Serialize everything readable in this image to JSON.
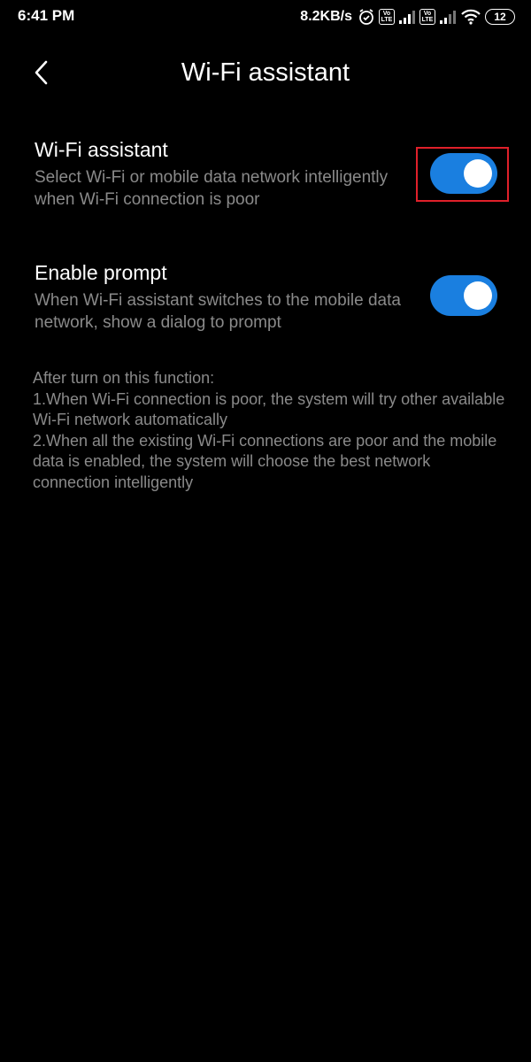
{
  "status_bar": {
    "time": "6:41 PM",
    "speed": "8.2KB/s",
    "battery": "12",
    "volte_label_top": "Vo",
    "volte_label_bottom": "LTE"
  },
  "header": {
    "title": "Wi-Fi assistant"
  },
  "settings": [
    {
      "title": "Wi-Fi assistant",
      "description": "Select Wi-Fi or mobile data network intelligently when Wi-Fi connection is poor",
      "enabled": true
    },
    {
      "title": "Enable prompt",
      "description": "When Wi-Fi assistant switches to the mobile data network, show a dialog to prompt",
      "enabled": true
    }
  ],
  "info": {
    "line1": "After turn on this function:",
    "line2": "1.When Wi-Fi connection is poor, the system will try other available Wi-Fi network automatically",
    "line3": "2.When all the existing Wi-Fi connections are poor and the mobile data is enabled, the system will choose the best network connection intelligently"
  },
  "colors": {
    "background": "#000000",
    "toggle_on": "#1a7fe0",
    "secondary_text": "#8a8a8a",
    "highlight": "#e0202a"
  }
}
